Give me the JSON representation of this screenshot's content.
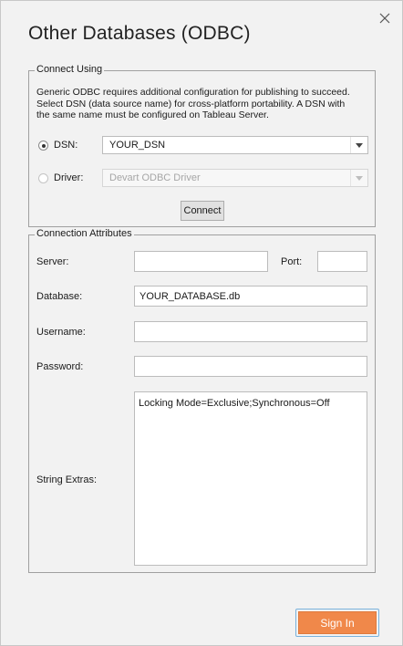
{
  "dialog": {
    "title": "Other Databases (ODBC)",
    "close_icon": "close-icon"
  },
  "connect_using": {
    "legend": "Connect Using",
    "description": "Generic ODBC requires additional configuration for publishing to succeed. Select DSN (data source name) for cross-platform portability. A DSN with the same name must be configured on Tableau Server.",
    "dsn_label": "DSN:",
    "dsn_value": "YOUR_DSN",
    "dsn_selected": true,
    "driver_label": "Driver:",
    "driver_value": "Devart ODBC Driver",
    "driver_enabled": false,
    "connect_label": "Connect"
  },
  "attributes": {
    "legend": "Connection Attributes",
    "server_label": "Server:",
    "server_value": "",
    "port_label": "Port:",
    "port_value": "",
    "database_label": "Database:",
    "database_value": "YOUR_DATABASE.db",
    "username_label": "Username:",
    "username_value": "",
    "password_label": "Password:",
    "password_value": "",
    "string_extras_label": "String Extras:",
    "string_extras_value": "Locking Mode=Exclusive;Synchronous=Off"
  },
  "footer": {
    "sign_in_label": "Sign In"
  },
  "colors": {
    "accent": "#f0884a",
    "focus_border": "#79b2dc"
  }
}
